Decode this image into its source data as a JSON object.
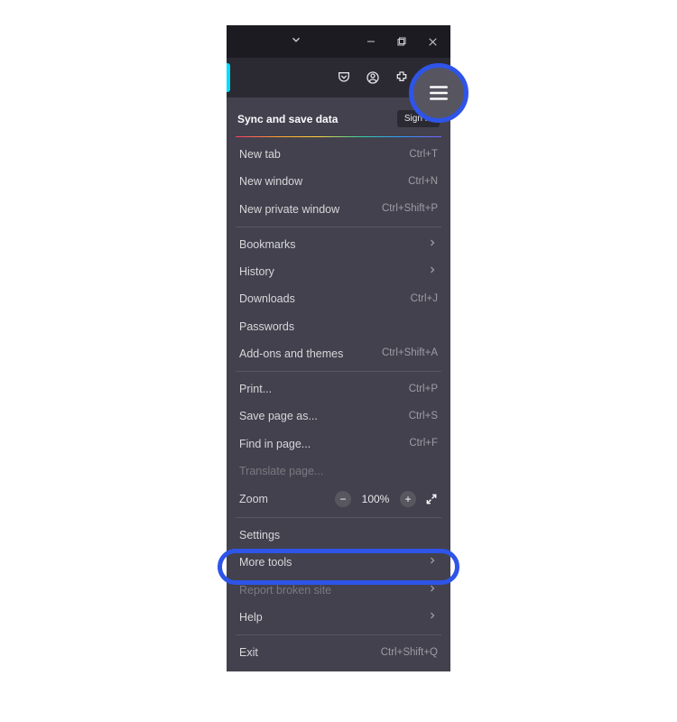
{
  "sync": {
    "label": "Sync and save data",
    "signin": "Sign In"
  },
  "group1": [
    {
      "label": "New tab",
      "shortcut": "Ctrl+T"
    },
    {
      "label": "New window",
      "shortcut": "Ctrl+N"
    },
    {
      "label": "New private window",
      "shortcut": "Ctrl+Shift+P"
    }
  ],
  "group2": {
    "bookmarks": "Bookmarks",
    "history": "History",
    "downloads": {
      "label": "Downloads",
      "shortcut": "Ctrl+J"
    },
    "passwords": "Passwords",
    "addons": {
      "label": "Add-ons and themes",
      "shortcut": "Ctrl+Shift+A"
    }
  },
  "group3": {
    "print": {
      "label": "Print...",
      "shortcut": "Ctrl+P"
    },
    "save": {
      "label": "Save page as...",
      "shortcut": "Ctrl+S"
    },
    "find": {
      "label": "Find in page...",
      "shortcut": "Ctrl+F"
    },
    "translate": "Translate page..."
  },
  "zoom": {
    "label": "Zoom",
    "value": "100%"
  },
  "settings": "Settings",
  "moretools": "More tools",
  "report": "Report broken site",
  "help": "Help",
  "exit": {
    "label": "Exit",
    "shortcut": "Ctrl+Shift+Q"
  }
}
